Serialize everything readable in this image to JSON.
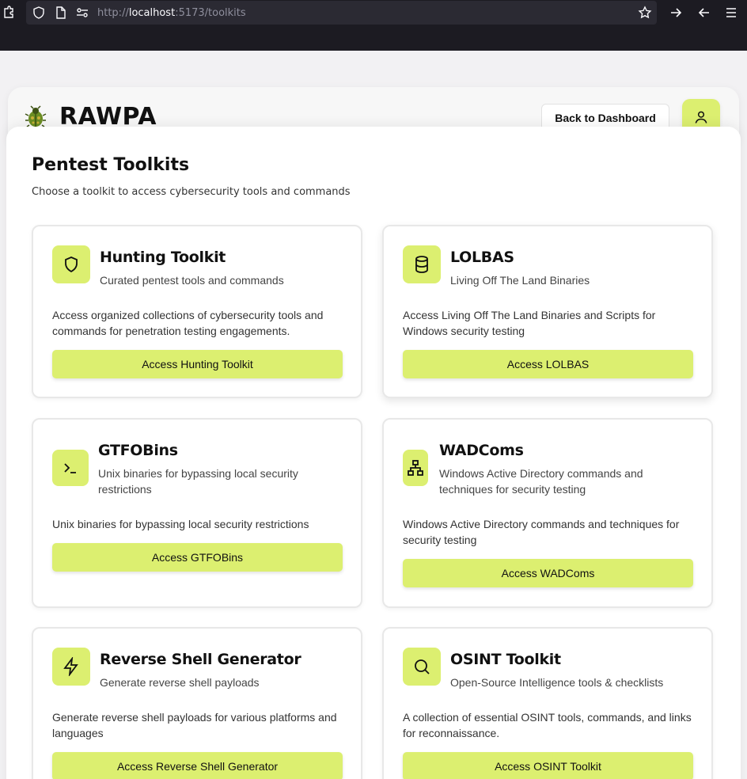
{
  "browser": {
    "url_prefix": "http://",
    "url_host": "localhost",
    "url_rest": ":5173/toolkits"
  },
  "header": {
    "brand": "RAWPA",
    "back_button": "Back to Dashboard"
  },
  "main": {
    "title": "Pentest Toolkits",
    "subtitle": "Choose a toolkit to access cybersecurity tools and commands"
  },
  "cards": [
    {
      "title": "Hunting Toolkit",
      "subtitle": "Curated pentest tools and commands",
      "description": "Access organized collections of cybersecurity tools and commands for penetration testing engagements.",
      "button": "Access Hunting Toolkit",
      "icon": "shield-icon"
    },
    {
      "title": "LOLBAS",
      "subtitle": "Living Off The Land Binaries",
      "description": "Access Living Off The Land Binaries and Scripts for Windows security testing",
      "button": "Access LOLBAS",
      "icon": "database-icon"
    },
    {
      "title": "GTFOBins",
      "subtitle": "Unix binaries for bypassing local security restrictions",
      "description": "Unix binaries for bypassing local security restrictions",
      "button": "Access GTFOBins",
      "icon": "terminal-icon"
    },
    {
      "title": "WADComs",
      "subtitle": "Windows Active Directory commands and techniques for security testing",
      "description": "Windows Active Directory commands and techniques for security testing",
      "button": "Access WADComs",
      "icon": "network-icon"
    },
    {
      "title": "Reverse Shell Generator",
      "subtitle": "Generate reverse shell payloads",
      "description": "Generate reverse shell payloads for various platforms and languages",
      "button": "Access Reverse Shell Generator",
      "icon": "zap-icon"
    },
    {
      "title": "OSINT Toolkit",
      "subtitle": "Open-Source Intelligence tools & checklists",
      "description": "A collection of essential OSINT tools, commands, and links for reconnaissance.",
      "button": "Access OSINT Toolkit",
      "icon": "search-icon"
    }
  ],
  "colors": {
    "accent": "#dcef70",
    "chrome_bg": "#1c1b22",
    "page_bg": "#f2f1f3"
  }
}
